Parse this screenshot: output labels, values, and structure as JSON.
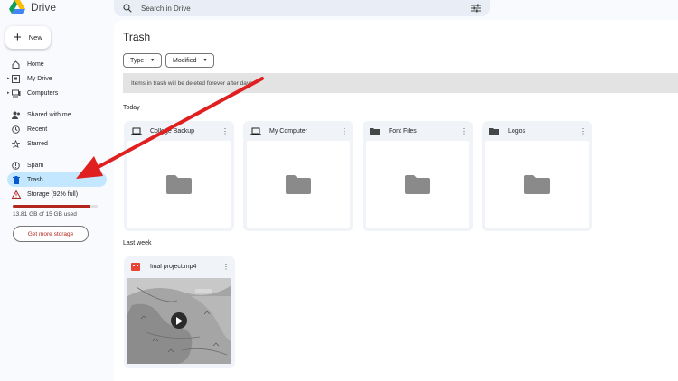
{
  "app": {
    "name": "Drive"
  },
  "search": {
    "placeholder": "Search in Drive"
  },
  "sidebar": {
    "new_label": "New",
    "items": [
      {
        "label": "Home",
        "icon": "home-icon"
      },
      {
        "label": "My Drive",
        "icon": "my-drive-icon"
      },
      {
        "label": "Computers",
        "icon": "computers-icon"
      },
      {
        "label": "Shared with me",
        "icon": "shared-icon"
      },
      {
        "label": "Recent",
        "icon": "clock-icon"
      },
      {
        "label": "Starred",
        "icon": "star-icon"
      },
      {
        "label": "Spam",
        "icon": "spam-icon"
      },
      {
        "label": "Trash",
        "icon": "trash-icon"
      },
      {
        "label": "Storage (92% full)",
        "icon": "warning-icon"
      }
    ],
    "storage": {
      "used_text": "13.81 GB of 15 GB used",
      "fraction": 0.92,
      "button": "Get more storage",
      "color": "#b3261e"
    }
  },
  "main": {
    "title": "Trash",
    "filters": [
      "Type",
      "Modified"
    ],
    "banner": "Items in trash will be deleted forever after    days",
    "sections": [
      {
        "label": "Today",
        "items": [
          {
            "name": "College Backup",
            "icon": "laptop-icon"
          },
          {
            "name": "My Computer",
            "icon": "laptop-icon"
          },
          {
            "name": "Font Files",
            "icon": "folder-icon"
          },
          {
            "name": "Logos",
            "icon": "folder-icon"
          }
        ]
      },
      {
        "label": "Last week",
        "items": [
          {
            "name": "final project.mp4",
            "icon": "video-file-icon"
          }
        ]
      }
    ]
  },
  "colors": {
    "accent": "#c2e7ff",
    "annotation_arrow": "#e02020"
  }
}
